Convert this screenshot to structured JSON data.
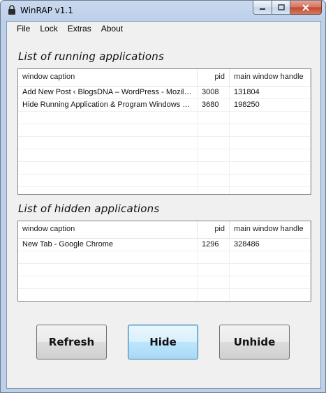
{
  "window": {
    "title": "WinRAP v1.1"
  },
  "menu": {
    "items": [
      "File",
      "Lock",
      "Extras",
      "About"
    ]
  },
  "running": {
    "heading": "List of running applications",
    "columns": [
      "window caption",
      "pid",
      "main window handle"
    ],
    "rows": [
      [
        "Add New Post ‹ BlogsDNA – WordPress - Mozilla ...",
        "3008",
        "131804"
      ],
      [
        "Hide Running Application & Program Windows wit...",
        "3680",
        "198250"
      ]
    ]
  },
  "hidden": {
    "heading": "List of hidden applications",
    "columns": [
      "window caption",
      "pid",
      "main window handle"
    ],
    "rows": [
      [
        "New Tab - Google Chrome",
        "1296",
        "328486"
      ]
    ]
  },
  "buttons": {
    "refresh": "Refresh",
    "hide": "Hide",
    "unhide": "Unhide"
  },
  "colors": {
    "titlebar": "#bcd0ea",
    "close_button": "#c4452b",
    "focus_border": "#3c7fb1"
  }
}
